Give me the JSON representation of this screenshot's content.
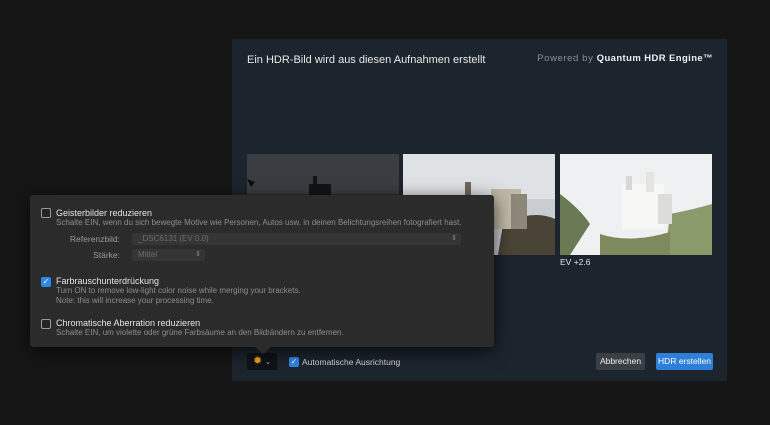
{
  "dialog": {
    "title": "Ein HDR-Bild wird aus diesen Aufnahmen erstellt",
    "powered_prefix": "Powered by",
    "powered_brand": "Quantum HDR Engine™"
  },
  "thumbnails": [
    {
      "name": "dark-exposure",
      "ev": ""
    },
    {
      "name": "normal-exposure",
      "ev": ""
    },
    {
      "name": "bright-exposure",
      "ev": "EV +2.6"
    }
  ],
  "footer": {
    "settings_icon": "gear-icon",
    "auto_align_label": "Automatische Ausrichtung",
    "auto_align_checked": true,
    "cancel_label": "Abbrechen",
    "create_label": "HDR erstellen"
  },
  "popover": {
    "ghost": {
      "title": "Geisterbilder reduzieren",
      "desc": "Schalte EIN, wenn du sich bewegte Motive wie Personen, Autos usw. in deinen Belichtungsreihen fotografiert hast.",
      "checked": false,
      "reference_label": "Referenzbild:",
      "reference_value": "_DSC6131 (EV 0.0)",
      "strength_label": "Stärke:",
      "strength_value": "Mittel"
    },
    "noise": {
      "title": "Farbrauschunterdrückung",
      "desc1": "Turn ON to remove low-light color noise while merging your brackets.",
      "desc2": "Note: this will increase your processing time.",
      "checked": true
    },
    "aberration": {
      "title": "Chromatische Aberration reduzieren",
      "desc": "Schalte EIN, um violette oder grüne Farbsäume an den Bildrändern zu entfernen.",
      "checked": false
    }
  },
  "colors": {
    "accent": "#2d7fd8",
    "dialog_bg": "#1c242d",
    "popover_bg": "#2b2b2b",
    "gear": "#f2a417"
  }
}
